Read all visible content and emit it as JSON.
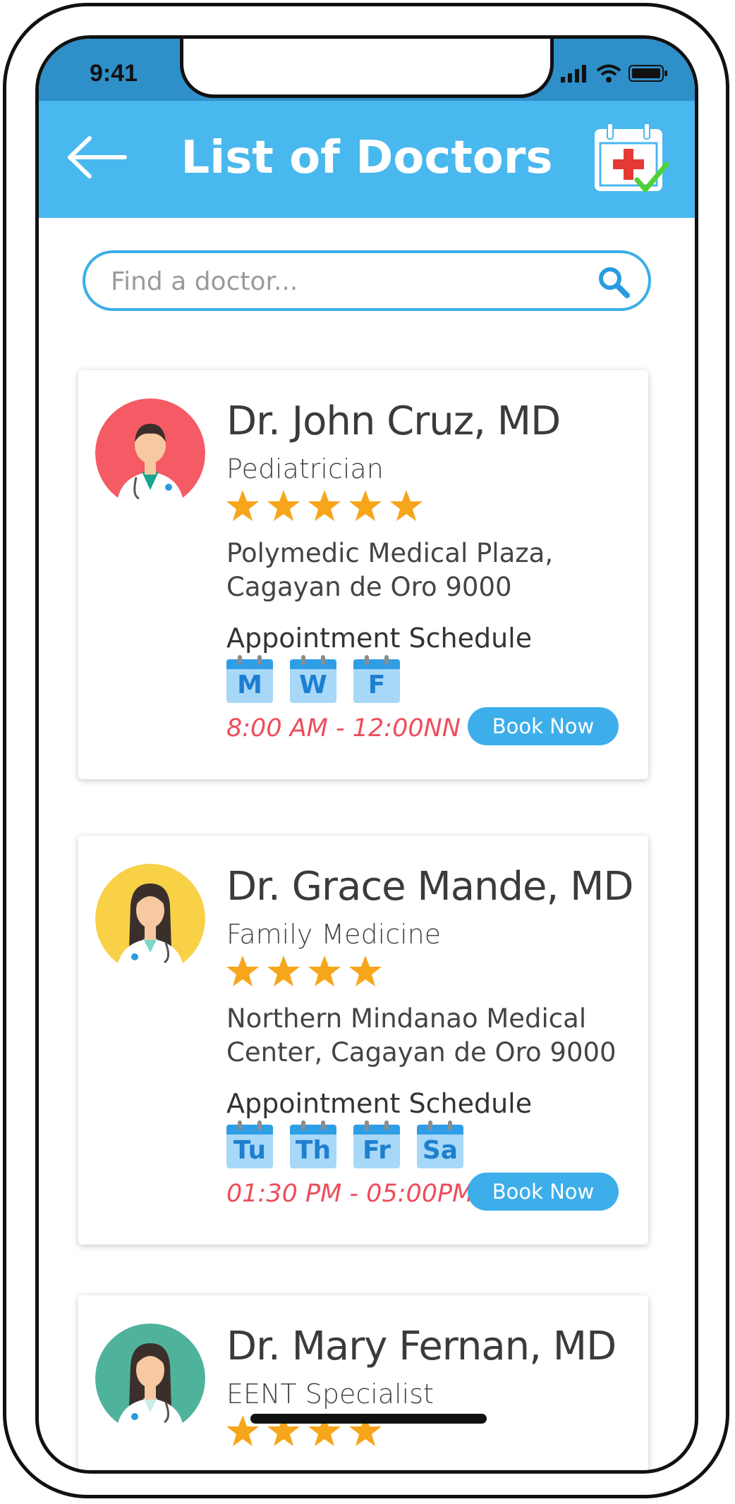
{
  "status": {
    "time": "9:41"
  },
  "header": {
    "title": "List of Doctors",
    "back_icon": "arrow-left-icon",
    "action_icon": "calendar-medical-check-icon"
  },
  "search": {
    "placeholder": "Find a doctor..."
  },
  "colors": {
    "appbar": "#49b8ee",
    "accent": "#3eaeea",
    "hours": "#ee4d5c",
    "star": "#f7a51b"
  },
  "doctors": [
    {
      "name": "Dr. John Cruz, MD",
      "specialty": "Pediatrician",
      "rating": 5,
      "address_line1": "Polymedic Medical Plaza,",
      "address_line2": "Cagayan de Oro 9000",
      "schedule_label": "Appointment Schedule",
      "days": [
        "M",
        "W",
        "F"
      ],
      "hours": "8:00 AM - 12:00NN",
      "book_label": "Book Now",
      "avatar_color": "#f45b64"
    },
    {
      "name": "Dr. Grace Mande, MD",
      "specialty": "Family Medicine",
      "rating": 4,
      "address_line1": "Northern Mindanao Medical",
      "address_line2": "Center, Cagayan de Oro 9000",
      "schedule_label": "Appointment Schedule",
      "days": [
        "Tu",
        "Th",
        "Fr",
        "Sa"
      ],
      "hours": "01:30 PM - 05:00PM",
      "book_label": "Book Now",
      "avatar_color": "#f8d147"
    },
    {
      "name": "Dr. Mary Fernan, MD",
      "specialty": "EENT Specialist",
      "rating": 4,
      "avatar_color": "#4fb39b"
    }
  ]
}
